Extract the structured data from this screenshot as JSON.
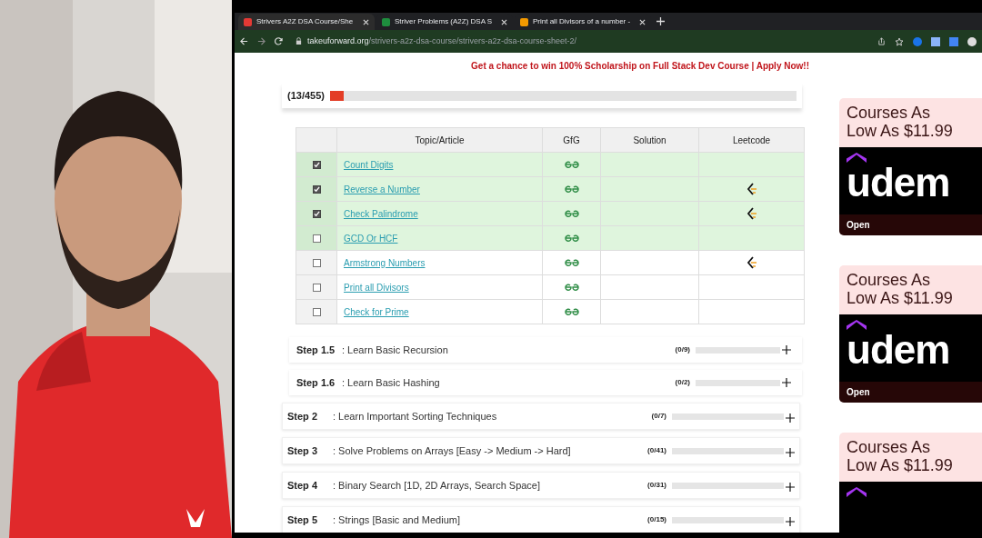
{
  "browser": {
    "tabs": [
      {
        "title": "Strivers A2Z DSA Course/She",
        "selected": true
      },
      {
        "title": "Striver Problems (A2Z) DSA S",
        "selected": false
      },
      {
        "title": "Print all Divisors of a number -",
        "selected": false
      }
    ],
    "url_domain": "takeuforward.org",
    "url_path": "/strivers-a2z-dsa-course/strivers-a2z-dsa-course-sheet-2/"
  },
  "banner": "Get a chance to win 100% Scholarship on Full Stack Dev Course | Apply Now!!",
  "progress": {
    "count": "(13/455)",
    "level": 0.029
  },
  "table": {
    "columns": [
      "Topic/Article",
      "GfG",
      "Solution",
      "Leetcode"
    ],
    "rows": [
      {
        "topic": "Count Digits",
        "checked": true,
        "highlighted": true,
        "leetcode": false
      },
      {
        "topic": "Reverse a Number",
        "checked": true,
        "highlighted": true,
        "leetcode": true
      },
      {
        "topic": "Check Palindrome",
        "checked": true,
        "highlighted": true,
        "leetcode": true
      },
      {
        "topic": "GCD Or HCF",
        "checked": false,
        "highlighted": true,
        "leetcode": false
      },
      {
        "topic": "Armstrong Numbers",
        "checked": false,
        "highlighted": false,
        "leetcode": true
      },
      {
        "topic": "Print all Divisors",
        "checked": false,
        "highlighted": false,
        "leetcode": false
      },
      {
        "topic": "Check for Prime",
        "checked": false,
        "highlighted": false,
        "leetcode": false
      }
    ]
  },
  "steps": [
    {
      "kind": "substep",
      "label": "Step 1.5",
      "title": ": Learn Basic Recursion",
      "count": "(0/9)",
      "level": 0
    },
    {
      "kind": "substep",
      "label": "Step 1.6",
      "title": ": Learn Basic Hashing",
      "count": "(0/2)",
      "level": 0
    },
    {
      "kind": "step",
      "label": "Step 2",
      "title": ": Learn Important Sorting Techniques",
      "count": "(0/7)",
      "level": 0
    },
    {
      "kind": "step",
      "label": "Step 3",
      "title": ": Solve Problems on Arrays [Easy -> Medium -> Hard]",
      "count": "(0/41)",
      "level": 0
    },
    {
      "kind": "step",
      "label": "Step 4",
      "title": ": Binary Search [1D, 2D Arrays, Search Space]",
      "count": "(0/31)",
      "level": 0
    },
    {
      "kind": "step",
      "label": "Step 5",
      "title": ": Strings [Basic and Medium]",
      "count": "(0/15)",
      "level": 0
    }
  ],
  "ads": [
    {
      "title": "Courses As Low As $11.99",
      "logo": "udem",
      "button": "Open"
    },
    {
      "title": "Courses As Low As $11.99",
      "logo": "udem",
      "button": "Open"
    },
    {
      "title": "Courses As Low As $11.99"
    }
  ]
}
